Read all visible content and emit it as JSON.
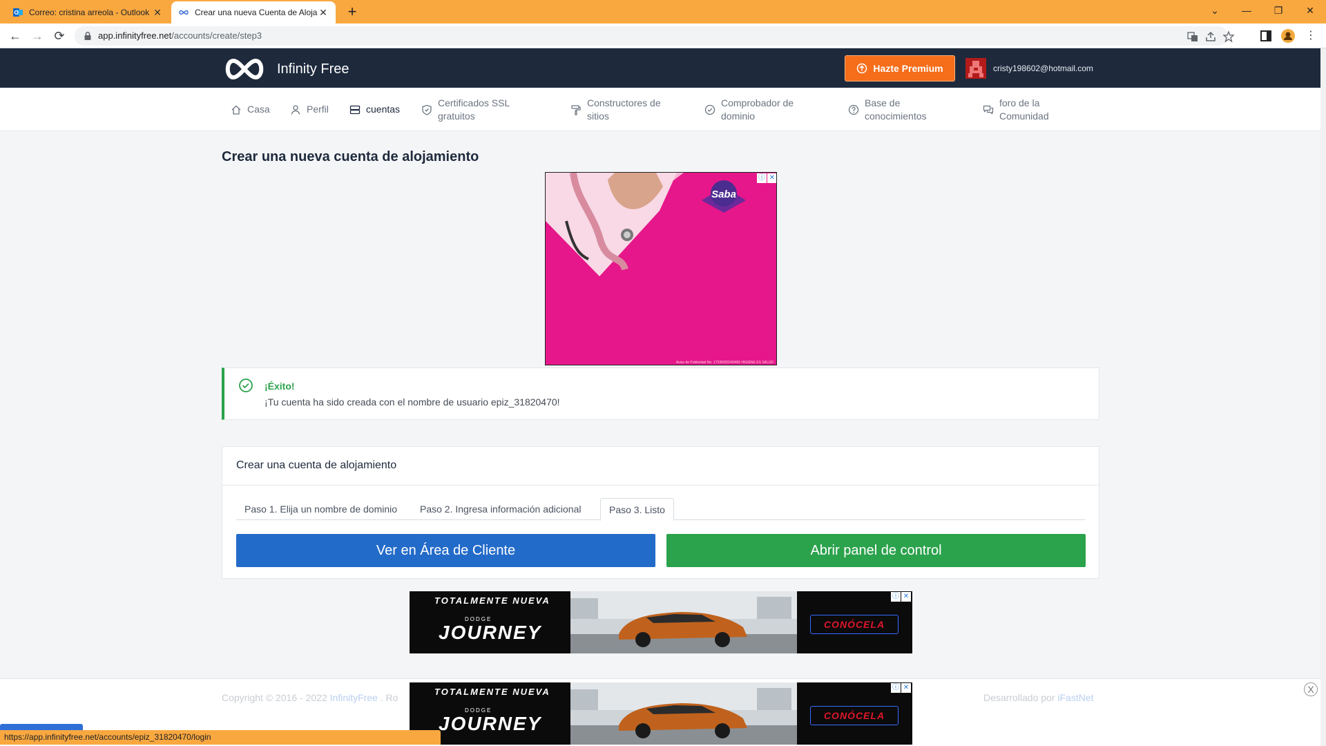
{
  "browser": {
    "tabs": [
      {
        "title": "Correo: cristina arreola - Outlook",
        "active": false
      },
      {
        "title": "Crear una nueva Cuenta de Aloja",
        "active": true
      }
    ],
    "new_tab": "+",
    "url_host": "app.infinityfree.net",
    "url_path": "/accounts/create/step3",
    "status_url": "https://app.infinityfree.net/accounts/epiz_31820470/login"
  },
  "header": {
    "brand": "Infinity Free",
    "premium_label": "Hazte Premium",
    "user_email": "cristy198602@hotmail.com"
  },
  "nav": {
    "items": [
      {
        "label": "Casa",
        "icon": "home-icon"
      },
      {
        "label": "Perfil",
        "icon": "user-icon"
      },
      {
        "label": "cuentas",
        "icon": "server-icon"
      },
      {
        "label": "Certificados SSL gratuitos",
        "icon": "shield-icon"
      },
      {
        "label": "Constructores de sitios",
        "icon": "paint-roller-icon"
      },
      {
        "label": "Comprobador de dominio",
        "icon": "check-circle-icon"
      },
      {
        "label": "Base de conocimientos",
        "icon": "question-circle-icon"
      },
      {
        "label": "foro de la Comunidad",
        "icon": "comments-icon"
      }
    ]
  },
  "main": {
    "title": "Crear una nueva cuenta de alojamiento",
    "ad_brand": "Saba",
    "ad_fineprint": "Aviso de Publicidad No. 17330020240456 HIGIENE ES SALUD",
    "alert": {
      "title": "¡Éxito!",
      "message": "¡Tu cuenta ha sido creada con el nombre de usuario epiz_31820470!"
    },
    "card": {
      "title": "Crear una cuenta de alojamiento",
      "steps": [
        "Paso 1. Elija un nombre de dominio",
        "Paso 2. Ingresa información adicional",
        "Paso 3. Listo"
      ],
      "button_client": "Ver en Área de Cliente",
      "button_panel": "Abrir panel de control"
    }
  },
  "banner_ad": {
    "tagline": "TOTALMENTE NUEVA",
    "brand": "DODGE",
    "model": "JOURNEY",
    "cta": "CONÓCELA"
  },
  "footer": {
    "copyright_prefix": "Copyright © 2016 - 2022 ",
    "copyright_link": "InfinityFree",
    "copyright_suffix": " . Ro",
    "dev_prefix": "Desarrollado por ",
    "dev_link": "iFastNet",
    "close": "X"
  },
  "colors": {
    "header_bg": "#1e2a3c",
    "premium": "#f66d1a",
    "success": "#2ba24c",
    "primary": "#236bc9",
    "tabbar": "#f9a840"
  }
}
